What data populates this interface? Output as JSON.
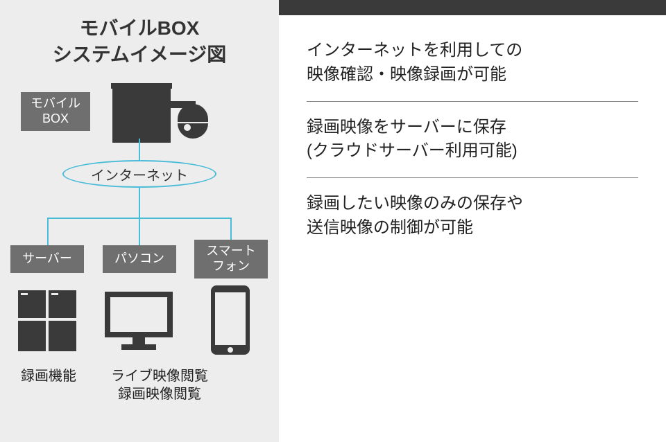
{
  "title_line1": "モバイルBOX",
  "title_line2": "システムイメージ図",
  "labels": {
    "mobilebox_l1": "モバイル",
    "mobilebox_l2": "BOX",
    "internet": "インターネット",
    "server": "サーバー",
    "pc": "パソコン",
    "phone_l1": "スマート",
    "phone_l2": "フォン"
  },
  "captions": {
    "server": "録画機能",
    "pc_l1": "ライブ映像閲覧",
    "pc_l2": "録画映像閲覧"
  },
  "features": {
    "f1_l1": "インターネットを利用しての",
    "f1_l2": "映像確認・映像録画が可能",
    "f2_l1": "録画映像をサーバーに保存",
    "f2_l2": "(クラウドサーバー利用可能)",
    "f3_l1": "録画したい映像のみの保存や",
    "f3_l2": "送信映像の制御が可能"
  }
}
